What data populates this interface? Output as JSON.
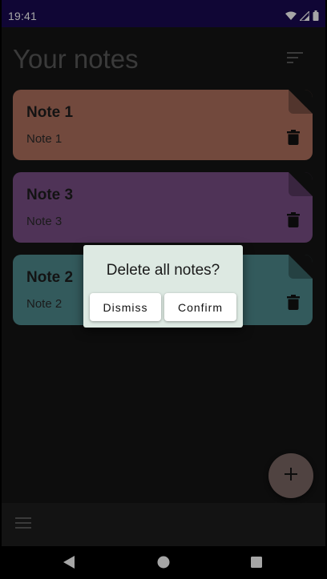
{
  "status_bar": {
    "time": "19:41",
    "icons": [
      "wifi-icon",
      "signal-icon",
      "battery-icon"
    ]
  },
  "header": {
    "title": "Your notes",
    "sort_icon": "sort-icon"
  },
  "notes": [
    {
      "title": "Note 1",
      "content": "Note 1",
      "color": "#b0715f"
    },
    {
      "title": "Note 3",
      "content": "Note 3",
      "color": "#7a4f86"
    },
    {
      "title": "Note 2",
      "content": "Note 2",
      "color": "#4f8a8e"
    }
  ],
  "fab": {
    "icon": "plus-icon"
  },
  "bottom_bar": {
    "menu_icon": "menu-icon"
  },
  "nav_bar": {
    "icons": [
      "back-icon",
      "home-icon",
      "recents-icon"
    ]
  },
  "dialog": {
    "title": "Delete all notes?",
    "dismiss_label": "Dismiss",
    "confirm_label": "Confirm"
  },
  "colors": {
    "status_bar": "#1a0a52",
    "background": "#141414",
    "dialog_background": "#dde9e2",
    "fab": "#7c6764"
  }
}
